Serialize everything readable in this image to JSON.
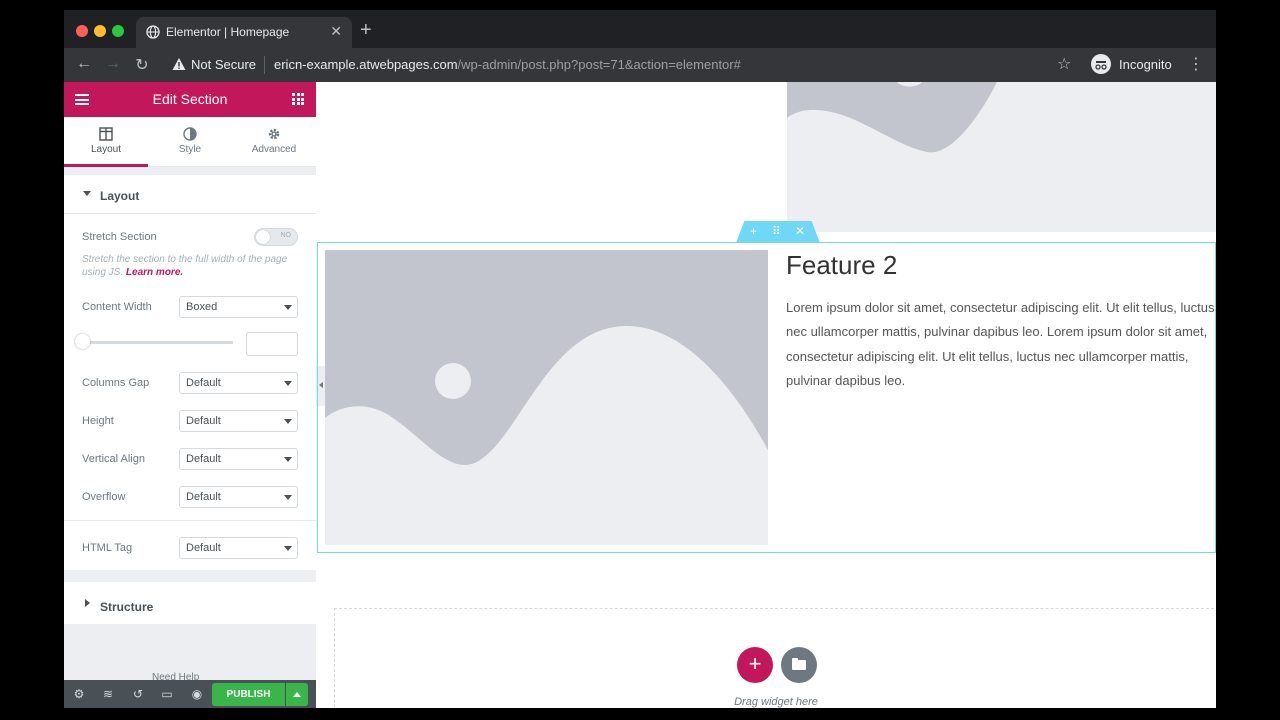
{
  "browser": {
    "tab_title": "Elementor | Homepage",
    "security_label": "Not Secure",
    "url_host": "ericn-example.atwebpages.com",
    "url_path": "/wp-admin/post.php?post=71&action=elementor#",
    "profile_label": "Incognito"
  },
  "panel": {
    "header_title": "Edit Section",
    "tabs": [
      {
        "label": "Layout",
        "icon": "columns-icon",
        "active": true
      },
      {
        "label": "Style",
        "icon": "half-circle-icon",
        "active": false
      },
      {
        "label": "Advanced",
        "icon": "gear-icon",
        "active": false
      }
    ],
    "layout_section": {
      "title": "Layout",
      "stretch_label": "Stretch Section",
      "stretch_toggle": "NO",
      "stretch_desc": "Stretch the section to the full width of the page using JS.",
      "learn_more": "Learn more.",
      "content_width_label": "Content Width",
      "content_width_value": "Boxed",
      "columns_gap_label": "Columns Gap",
      "columns_gap_value": "Default",
      "height_label": "Height",
      "height_value": "Default",
      "vertical_align_label": "Vertical Align",
      "vertical_align_value": "Default",
      "overflow_label": "Overflow",
      "overflow_value": "Default",
      "html_tag_label": "HTML Tag",
      "html_tag_value": "Default"
    },
    "structure_title": "Structure",
    "need_help": "Need Help",
    "publish_label": "PUBLISH"
  },
  "canvas": {
    "feature_title": "Feature 2",
    "feature_text": "Lorem ipsum dolor sit amet, consectetur adipiscing elit. Ut elit tellus, luctus nec ullamcorper mattis, pulvinar dapibus leo. Lorem ipsum dolor sit amet, consectetur adipiscing elit. Ut elit tellus, luctus nec ullamcorper mattis, pulvinar dapibus leo.",
    "drag_widget_text": "Drag widget here"
  },
  "colors": {
    "brand": "#c2185b",
    "publish": "#39b54a",
    "selection": "#71d7f7",
    "placeholder_dark": "#c2c5cd",
    "placeholder_light": "#eceef2"
  }
}
